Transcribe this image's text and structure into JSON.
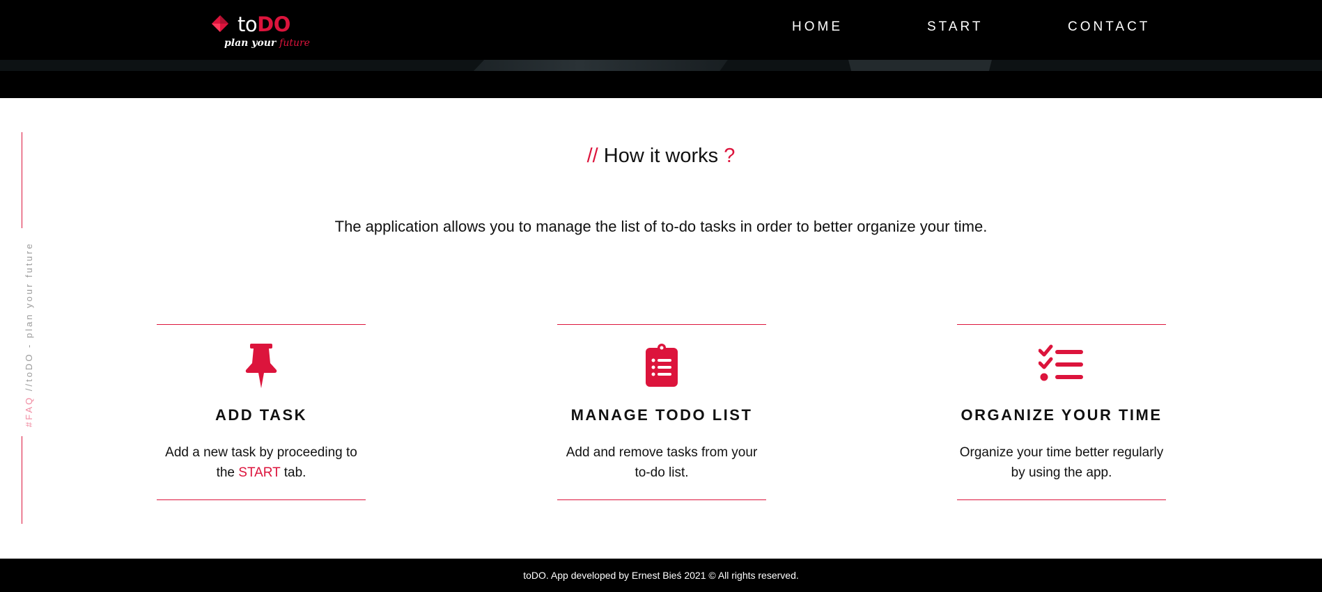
{
  "header": {
    "logo": {
      "text_plain": "to",
      "text_accent": "DO",
      "tagline_plain": "plan your",
      "tagline_accent": "future"
    },
    "nav": [
      {
        "label": "HOME"
      },
      {
        "label": "START"
      },
      {
        "label": "CONTACT"
      }
    ]
  },
  "side": {
    "faq": "#FAQ",
    "rest": " //toDO - plan your future"
  },
  "section": {
    "title_prefix": "//",
    "title": " How it works ",
    "title_suffix": "?",
    "intro": "The application allows you to manage the list of to-do tasks in order to better organize your time."
  },
  "cards": [
    {
      "icon": "pushpin-icon",
      "title": "ADD TASK",
      "desc_before": "Add a new task by proceeding to the ",
      "desc_link": "START",
      "desc_after": " tab."
    },
    {
      "icon": "clipboard-list-icon",
      "title": "MANAGE TODO LIST",
      "desc": "Add and remove tasks from your to-do list."
    },
    {
      "icon": "checklist-icon",
      "title": "ORGANIZE YOUR TIME",
      "desc": "Organize your time better regularly by using the app."
    }
  ],
  "footer": {
    "text": "toDO. App developed by Ernest Bieś 2021 © All rights reserved."
  },
  "colors": {
    "accent": "#dc143c",
    "header_bg": "#000000",
    "text": "#111111"
  }
}
